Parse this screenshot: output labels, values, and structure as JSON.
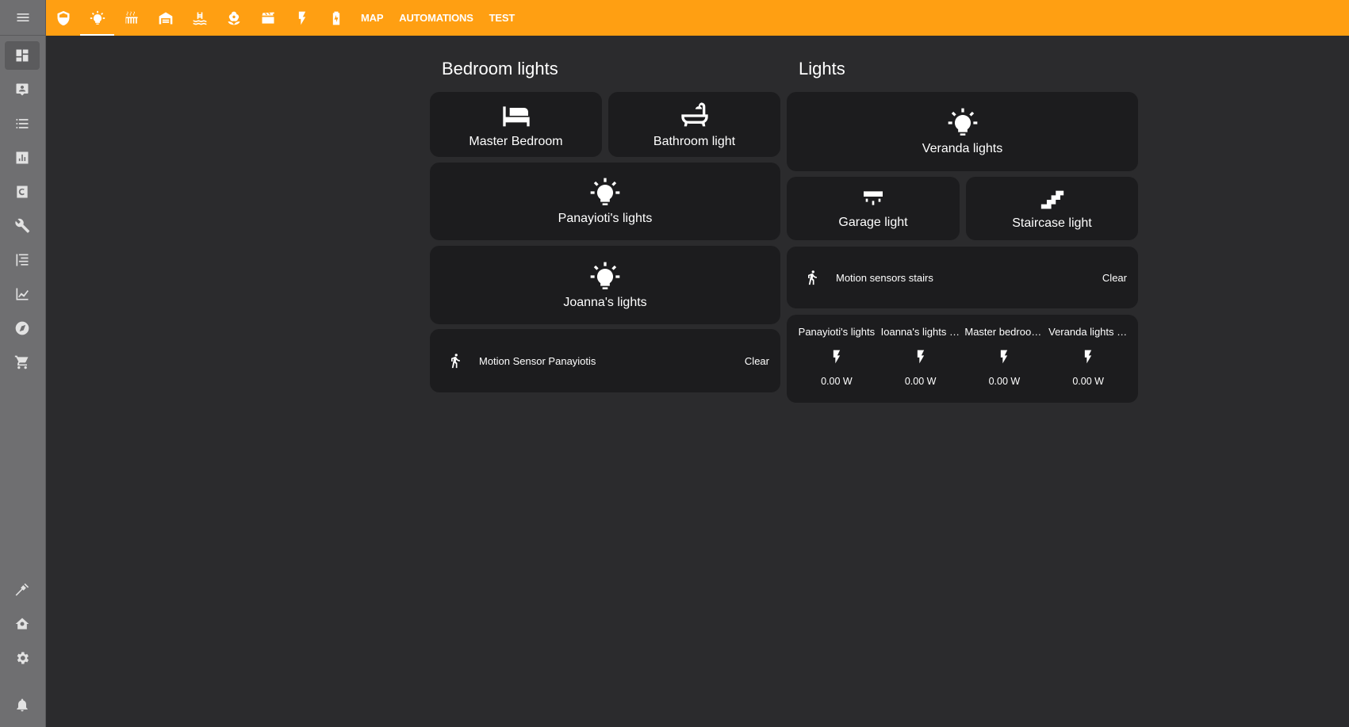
{
  "tabs": {
    "icons": [
      "shield-icon",
      "lightbulb-icon",
      "radiator-icon",
      "garage-icon",
      "pool-icon",
      "flower-icon",
      "clapperboard-icon",
      "flash-icon",
      "battery-icon"
    ],
    "active_index": 1,
    "text": [
      "MAP",
      "AUTOMATIONS",
      "TEST"
    ]
  },
  "sidebar": {
    "items": [
      "dashboard-icon",
      "account-icon",
      "list-icon",
      "chart-icon",
      "calendar-icon",
      "wrench-icon",
      "logbook-icon",
      "history-icon",
      "media-icon",
      "cart-icon"
    ],
    "bottom": [
      "hammer-icon",
      "home-settings-icon",
      "gear-icon",
      "bell-icon"
    ]
  },
  "left_column": {
    "title": "Bedroom lights",
    "master_bedroom": "Master Bedroom",
    "bathroom": "Bathroom light",
    "panayioti": "Panayioti's lights",
    "joanna": "Joanna's lights",
    "motion": {
      "name": "Motion Sensor Panayiotis",
      "state": "Clear"
    }
  },
  "right_column": {
    "title": "Lights",
    "veranda": "Veranda lights",
    "garage": "Garage light",
    "staircase": "Staircase light",
    "motion": {
      "name": "Motion sensors stairs",
      "state": "Clear"
    },
    "glance": [
      {
        "name": "Panayioti's lights",
        "value": "0.00 W"
      },
      {
        "name": "Ioanna's lights power",
        "value": "0.00 W"
      },
      {
        "name": "Master bedroom power",
        "value": "0.00 W"
      },
      {
        "name": "Veranda lights power",
        "value": "0.00 W"
      }
    ]
  },
  "colors": {
    "accent": "#ff9f12",
    "card": "#1c1c1e",
    "background": "#2b2b2d",
    "sidebar": "#6f6f71"
  }
}
